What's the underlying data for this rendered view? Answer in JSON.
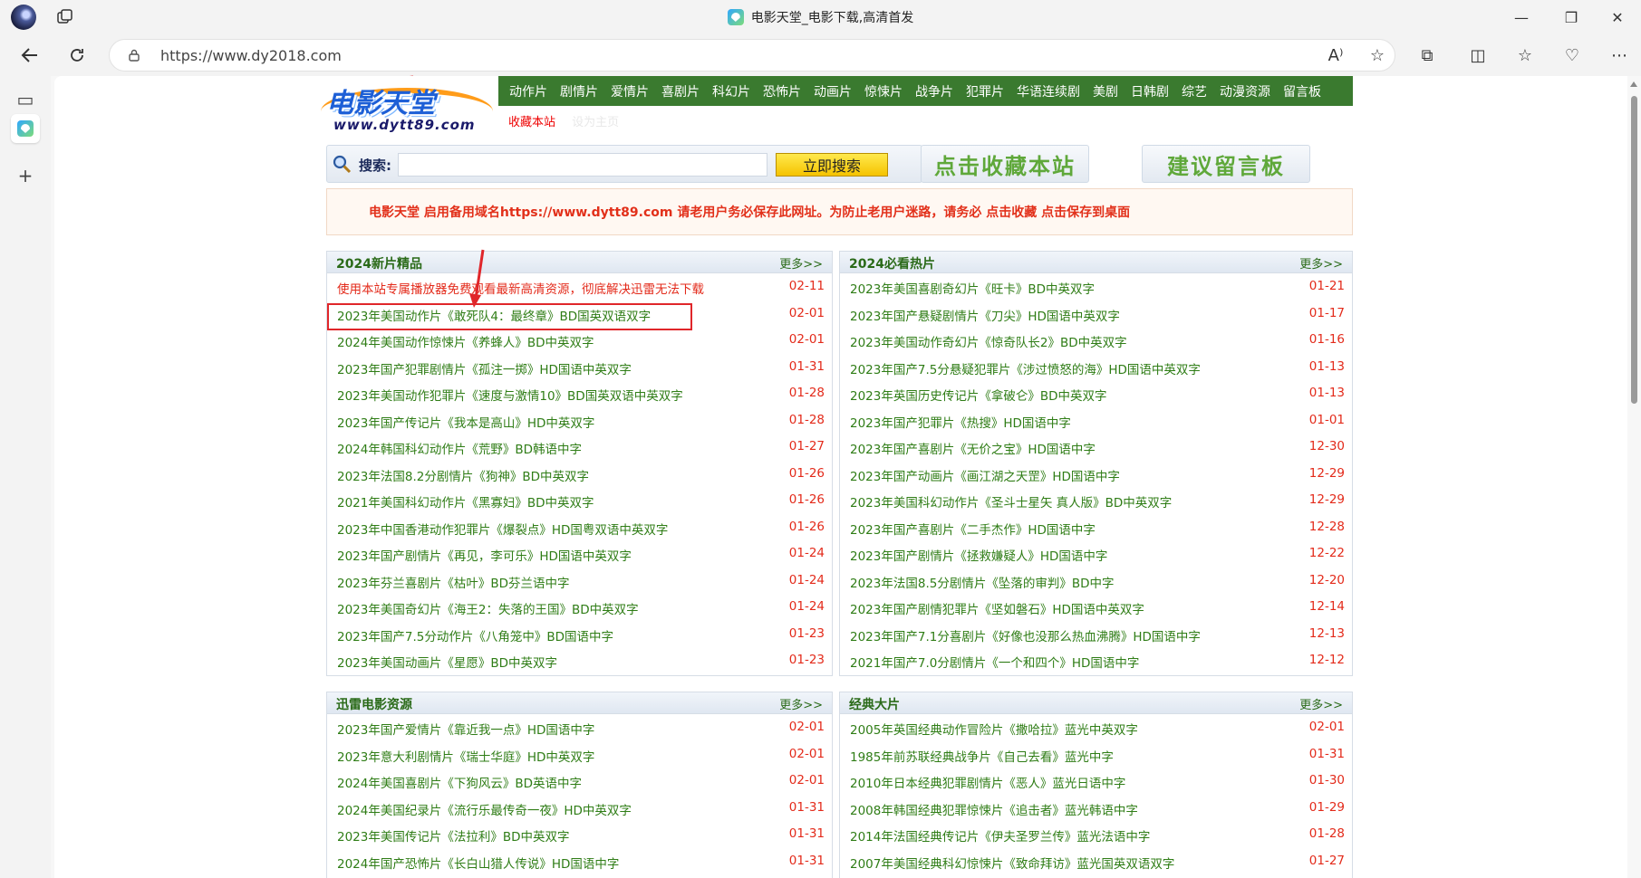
{
  "browser": {
    "window_title": "电影天堂_电影下载,高清首发",
    "url": "https://www.dy2018.com"
  },
  "site": {
    "logo_text": "电影天堂",
    "logo_domain": "www.dytt89.com",
    "menu": [
      "动作片",
      "剧情片",
      "爱情片",
      "喜剧片",
      "科幻片",
      "恐怖片",
      "动画片",
      "惊悚片",
      "战争片",
      "犯罪片",
      "华语连续剧",
      "美剧",
      "日韩剧",
      "综艺",
      "动漫资源",
      "留言板"
    ],
    "sublinks": {
      "bookmark": "收藏本站",
      "homepage": "设为主页"
    },
    "search": {
      "label": "搜索:",
      "placeholder": "",
      "button": "立即搜索"
    },
    "big_buttons": {
      "bookmark": "点击收藏本站",
      "guestbook": "建议留言板"
    },
    "notice": "电影天堂 启用备用域名https://www.dytt89.com 请老用户务必保存此网址。为防止老用户迷路，请务必 点击收藏 点击保存到桌面"
  },
  "panels": [
    {
      "title": "2024新片精品",
      "more": "更多>>",
      "items": [
        {
          "title": "使用本站专属播放器免费观看最新高清资源，彻底解决迅雷无法下载",
          "date": "02-11",
          "red": true
        },
        {
          "title": "2023年美国动作片《敢死队4：最终章》BD国英双语双字",
          "date": "02-01"
        },
        {
          "title": "2024年美国动作惊悚片《养蜂人》BD中英双字",
          "date": "02-01"
        },
        {
          "title": "2023年国产犯罪剧情片《孤注一掷》HD国语中英双字",
          "date": "01-31"
        },
        {
          "title": "2023年美国动作犯罪片《速度与激情10》BD国英双语中英双字",
          "date": "01-28"
        },
        {
          "title": "2023年国产传记片《我本是高山》HD中英双字",
          "date": "01-28"
        },
        {
          "title": "2024年韩国科幻动作片《荒野》BD韩语中字",
          "date": "01-27"
        },
        {
          "title": "2023年法国8.2分剧情片《狗神》BD中英双字",
          "date": "01-26"
        },
        {
          "title": "2021年美国科幻动作片《黑寡妇》BD中英双字",
          "date": "01-26"
        },
        {
          "title": "2023年中国香港动作犯罪片《爆裂点》HD国粤双语中英双字",
          "date": "01-26"
        },
        {
          "title": "2023年国产剧情片《再见，李可乐》HD国语中英双字",
          "date": "01-24"
        },
        {
          "title": "2023年芬兰喜剧片《枯叶》BD芬兰语中字",
          "date": "01-24"
        },
        {
          "title": "2023年美国奇幻片《海王2：失落的王国》BD中英双字",
          "date": "01-24"
        },
        {
          "title": "2023年国产7.5分动作片《八角笼中》BD国语中字",
          "date": "01-23"
        },
        {
          "title": "2023年美国动画片《星愿》BD中英双字",
          "date": "01-23"
        }
      ]
    },
    {
      "title": "2024必看热片",
      "more": "更多>>",
      "items": [
        {
          "title": "2023年美国喜剧奇幻片《旺卡》BD中英双字",
          "date": "01-21"
        },
        {
          "title": "2023年国产悬疑剧情片《刀尖》HD国语中英双字",
          "date": "01-17"
        },
        {
          "title": "2023年美国动作奇幻片《惊奇队长2》BD中英双字",
          "date": "01-16"
        },
        {
          "title": "2023年国产7.5分悬疑犯罪片《涉过愤怒的海》HD国语中英双字",
          "date": "01-13"
        },
        {
          "title": "2023年英国历史传记片《拿破仑》BD中英双字",
          "date": "01-13"
        },
        {
          "title": "2023年国产犯罪片《热搜》HD国语中字",
          "date": "01-01"
        },
        {
          "title": "2023年国产喜剧片《无价之宝》HD国语中字",
          "date": "12-30"
        },
        {
          "title": "2023年国产动画片《画江湖之天罡》HD国语中字",
          "date": "12-29"
        },
        {
          "title": "2023年美国科幻动作片《圣斗士星矢 真人版》BD中英双字",
          "date": "12-29"
        },
        {
          "title": "2023年国产喜剧片《二手杰作》HD国语中字",
          "date": "12-28"
        },
        {
          "title": "2023年国产剧情片《拯救嫌疑人》HD国语中字",
          "date": "12-22"
        },
        {
          "title": "2023年法国8.5分剧情片《坠落的审判》BD中字",
          "date": "12-20"
        },
        {
          "title": "2023年国产剧情犯罪片《坚如磐石》HD国语中英双字",
          "date": "12-14"
        },
        {
          "title": "2023年国产7.1分喜剧片《好像也没那么热血沸腾》HD国语中字",
          "date": "12-13"
        },
        {
          "title": "2021年国产7.0分剧情片《一个和四个》HD国语中字",
          "date": "12-12"
        }
      ]
    },
    {
      "title": "迅雷电影资源",
      "more": "更多>>",
      "items": [
        {
          "title": "2023年国产爱情片《靠近我一点》HD国语中字",
          "date": "02-01"
        },
        {
          "title": "2023年意大利剧情片《瑞士华庭》HD中英双字",
          "date": "02-01"
        },
        {
          "title": "2024年美国喜剧片《下狗风云》BD英语中字",
          "date": "02-01"
        },
        {
          "title": "2024年美国纪录片《流行乐最传奇一夜》HD中英双字",
          "date": "01-31"
        },
        {
          "title": "2023年美国传记片《法拉利》BD中英双字",
          "date": "01-31"
        },
        {
          "title": "2024年国产恐怖片《长白山猎人传说》HD国语中字",
          "date": "01-31"
        }
      ]
    },
    {
      "title": "经典大片",
      "more": "更多>>",
      "items": [
        {
          "title": "2005年英国经典动作冒险片《撒哈拉》蓝光中英双字",
          "date": "02-01"
        },
        {
          "title": "1985年前苏联经典战争片《自己去看》蓝光中字",
          "date": "01-31"
        },
        {
          "title": "2010年日本经典犯罪剧情片《恶人》蓝光日语中字",
          "date": "01-30"
        },
        {
          "title": "2008年韩国经典犯罪惊悚片《追击者》蓝光韩语中字",
          "date": "01-29"
        },
        {
          "title": "2014年法国经典传记片《伊夫圣罗兰传》蓝光法语中字",
          "date": "01-28"
        },
        {
          "title": "2007年美国经典科幻惊悚片《致命拜访》蓝光国英双语双字",
          "date": "01-27"
        }
      ]
    }
  ],
  "colors": {
    "menu_bg": "#3a7a2f",
    "link_green": "#2f7d16",
    "date_red": "#e32a1a",
    "highlight": "#e0262a"
  }
}
